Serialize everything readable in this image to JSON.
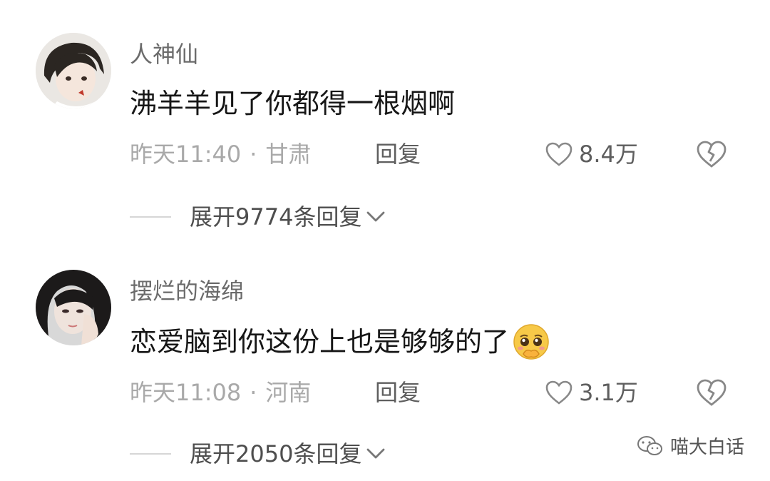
{
  "comments": [
    {
      "username": "人神仙",
      "text": "沸羊羊见了你都得一根烟啊",
      "time": "昨天11:40",
      "location": "甘肃",
      "reply_label": "回复",
      "likes": "8.4万",
      "expand_label": "展开9774条回复"
    },
    {
      "username": "摆烂的海绵",
      "text": "恋爱脑到你这份上也是够够的了",
      "time": "昨天11:08",
      "location": "河南",
      "reply_label": "回复",
      "likes": "3.1万",
      "expand_label": "展开2050条回复"
    }
  ],
  "separator": "·",
  "watermark": "喵大白话",
  "colors": {
    "text": "#161616",
    "meta": "#a9a9a9",
    "accent_emoji": "#f7c948"
  }
}
